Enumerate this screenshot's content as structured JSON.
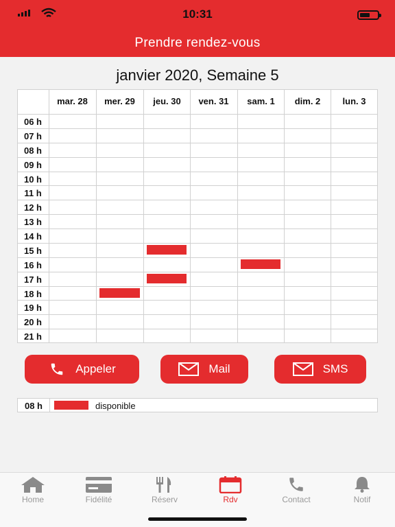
{
  "status": {
    "time": "10:31"
  },
  "header": {
    "title": "Prendre rendez-vous"
  },
  "calendar": {
    "title": "janvier 2020, Semaine 5",
    "days": [
      "mar. 28",
      "mer. 29",
      "jeu. 30",
      "ven. 31",
      "sam. 1",
      "dim. 2",
      "lun. 3"
    ],
    "hours": [
      "06 h",
      "07 h",
      "08 h",
      "09 h",
      "10 h",
      "11 h",
      "12 h",
      "13 h",
      "14 h",
      "15 h",
      "16 h",
      "17 h",
      "18 h",
      "19 h",
      "20 h",
      "21 h"
    ],
    "available_slots": [
      {
        "day": "mer. 29",
        "hour": "18 h"
      },
      {
        "day": "jeu. 30",
        "hour": "15 h"
      },
      {
        "day": "jeu. 30",
        "hour": "17 h"
      },
      {
        "day": "sam. 1",
        "hour": "16 h"
      }
    ]
  },
  "actions": {
    "call_label": "Appeler",
    "mail_label": "Mail",
    "sms_label": "SMS"
  },
  "legend": {
    "hour": "08 h",
    "text": "disponible"
  },
  "tabbar": {
    "items": [
      {
        "label": "Home",
        "icon": "home-icon",
        "active": false
      },
      {
        "label": "Fidélité",
        "icon": "card-icon",
        "active": false
      },
      {
        "label": "Réserv",
        "icon": "cutlery-icon",
        "active": false
      },
      {
        "label": "Rdv",
        "icon": "calendar-icon",
        "active": true
      },
      {
        "label": "Contact",
        "icon": "phone-icon",
        "active": false
      },
      {
        "label": "Notif",
        "icon": "bell-icon",
        "active": false
      }
    ]
  },
  "colors": {
    "accent": "#e42c2e",
    "inactive": "#9a9a9a",
    "grid_line": "#d0d0d0"
  }
}
